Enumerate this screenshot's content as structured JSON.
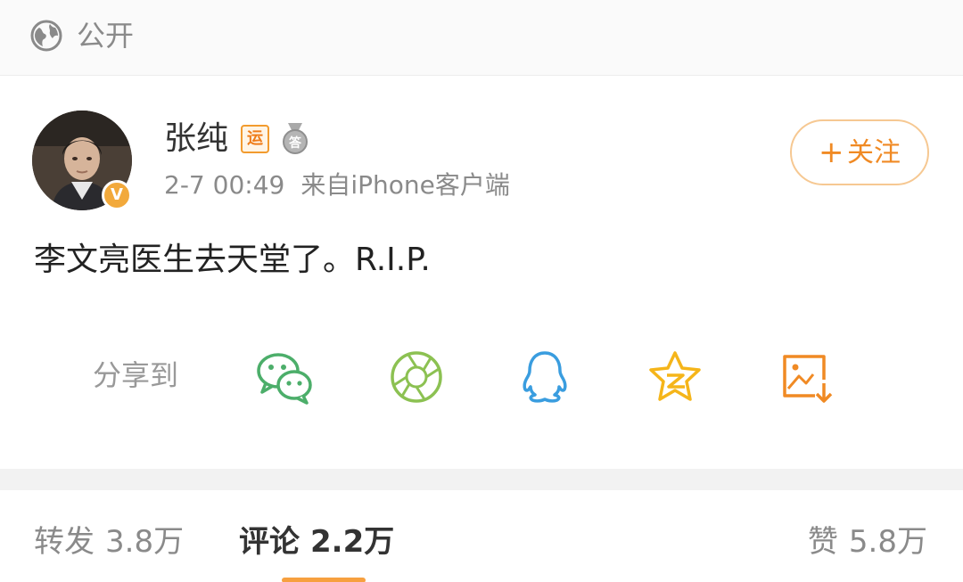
{
  "visibility": {
    "icon": "globe-icon",
    "label": "公开"
  },
  "post": {
    "author": {
      "name": "张纯",
      "verified": true,
      "verified_mark": "V",
      "badges": [
        {
          "icon": "yun-badge-icon",
          "text": "运"
        },
        {
          "icon": "da-medal-icon",
          "text": "答"
        }
      ]
    },
    "time": "2-7 00:49",
    "source": "来自iPhone客户端",
    "follow_button": {
      "plus": "+",
      "label": "关注"
    },
    "content": "李文亮医生去天堂了。R.I.P."
  },
  "share": {
    "label": "分享到",
    "targets": [
      {
        "icon": "wechat-icon",
        "color": "#4cae6a"
      },
      {
        "icon": "wechat-moments-icon",
        "color": "#8cc152"
      },
      {
        "icon": "qq-icon",
        "color": "#3a9ddf"
      },
      {
        "icon": "qzone-icon",
        "color": "#f5b51a"
      },
      {
        "icon": "save-image-icon",
        "color": "#f08a24"
      }
    ]
  },
  "stats": {
    "reposts": {
      "label": "转发",
      "count": "3.8万"
    },
    "comments": {
      "label": "评论",
      "count": "2.2万"
    },
    "likes": {
      "label": "赞",
      "count": "5.8万"
    }
  },
  "colors": {
    "accent": "#f08a24",
    "meta_text": "#8a8a8a",
    "divider": "#f2f2f2"
  }
}
